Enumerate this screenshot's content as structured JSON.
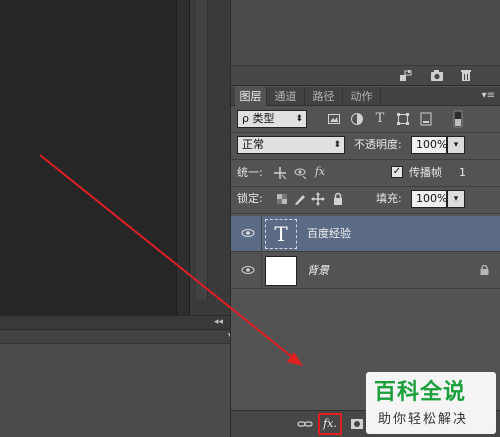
{
  "top_panel_footer": {
    "icons": [
      "adjust-icon",
      "camera-icon",
      "trash-icon"
    ]
  },
  "layers_panel": {
    "tabs": [
      {
        "label": "图层",
        "active": true
      },
      {
        "label": "通道",
        "active": false
      },
      {
        "label": "路径",
        "active": false
      },
      {
        "label": "动作",
        "active": false
      }
    ],
    "filter": {
      "search_glyph": "ρ",
      "kind_label": "类型",
      "filter_icons": [
        "image-filter-icon",
        "adjustment-filter-icon",
        "text-filter-icon",
        "shape-filter-icon",
        "smartobject-filter-icon"
      ]
    },
    "blend_mode": "正常",
    "opacity_label": "不透明度:",
    "opacity_value": "100%",
    "unify_label": "统一:",
    "propagate_label": "传播帧",
    "propagate_checked": true,
    "frame_number": "1",
    "lock_label": "锁定:",
    "fill_label": "填充:",
    "fill_value": "100%",
    "layers": [
      {
        "name": "百度经验",
        "type": "text",
        "thumb_glyph": "T",
        "visible": true,
        "selected": true,
        "locked": false
      },
      {
        "name": "背景",
        "type": "background",
        "visible": true,
        "selected": false,
        "locked": true
      }
    ],
    "footer_icons": [
      "link-icon",
      "fx-icon",
      "mask-icon"
    ],
    "fx_label": "fx."
  },
  "bottom_panel": {
    "collapse_glyph": "◂◂",
    "close_glyph": "×",
    "menu_glyph": "▾≡"
  },
  "watermark": {
    "title": "百科全说",
    "subtitle": "助你轻松解决"
  },
  "colors": {
    "selected_layer": "#5b6b85",
    "arrow": "#e02020",
    "highlight_box": "#e02020",
    "watermark_green": "#1a9f3a"
  }
}
